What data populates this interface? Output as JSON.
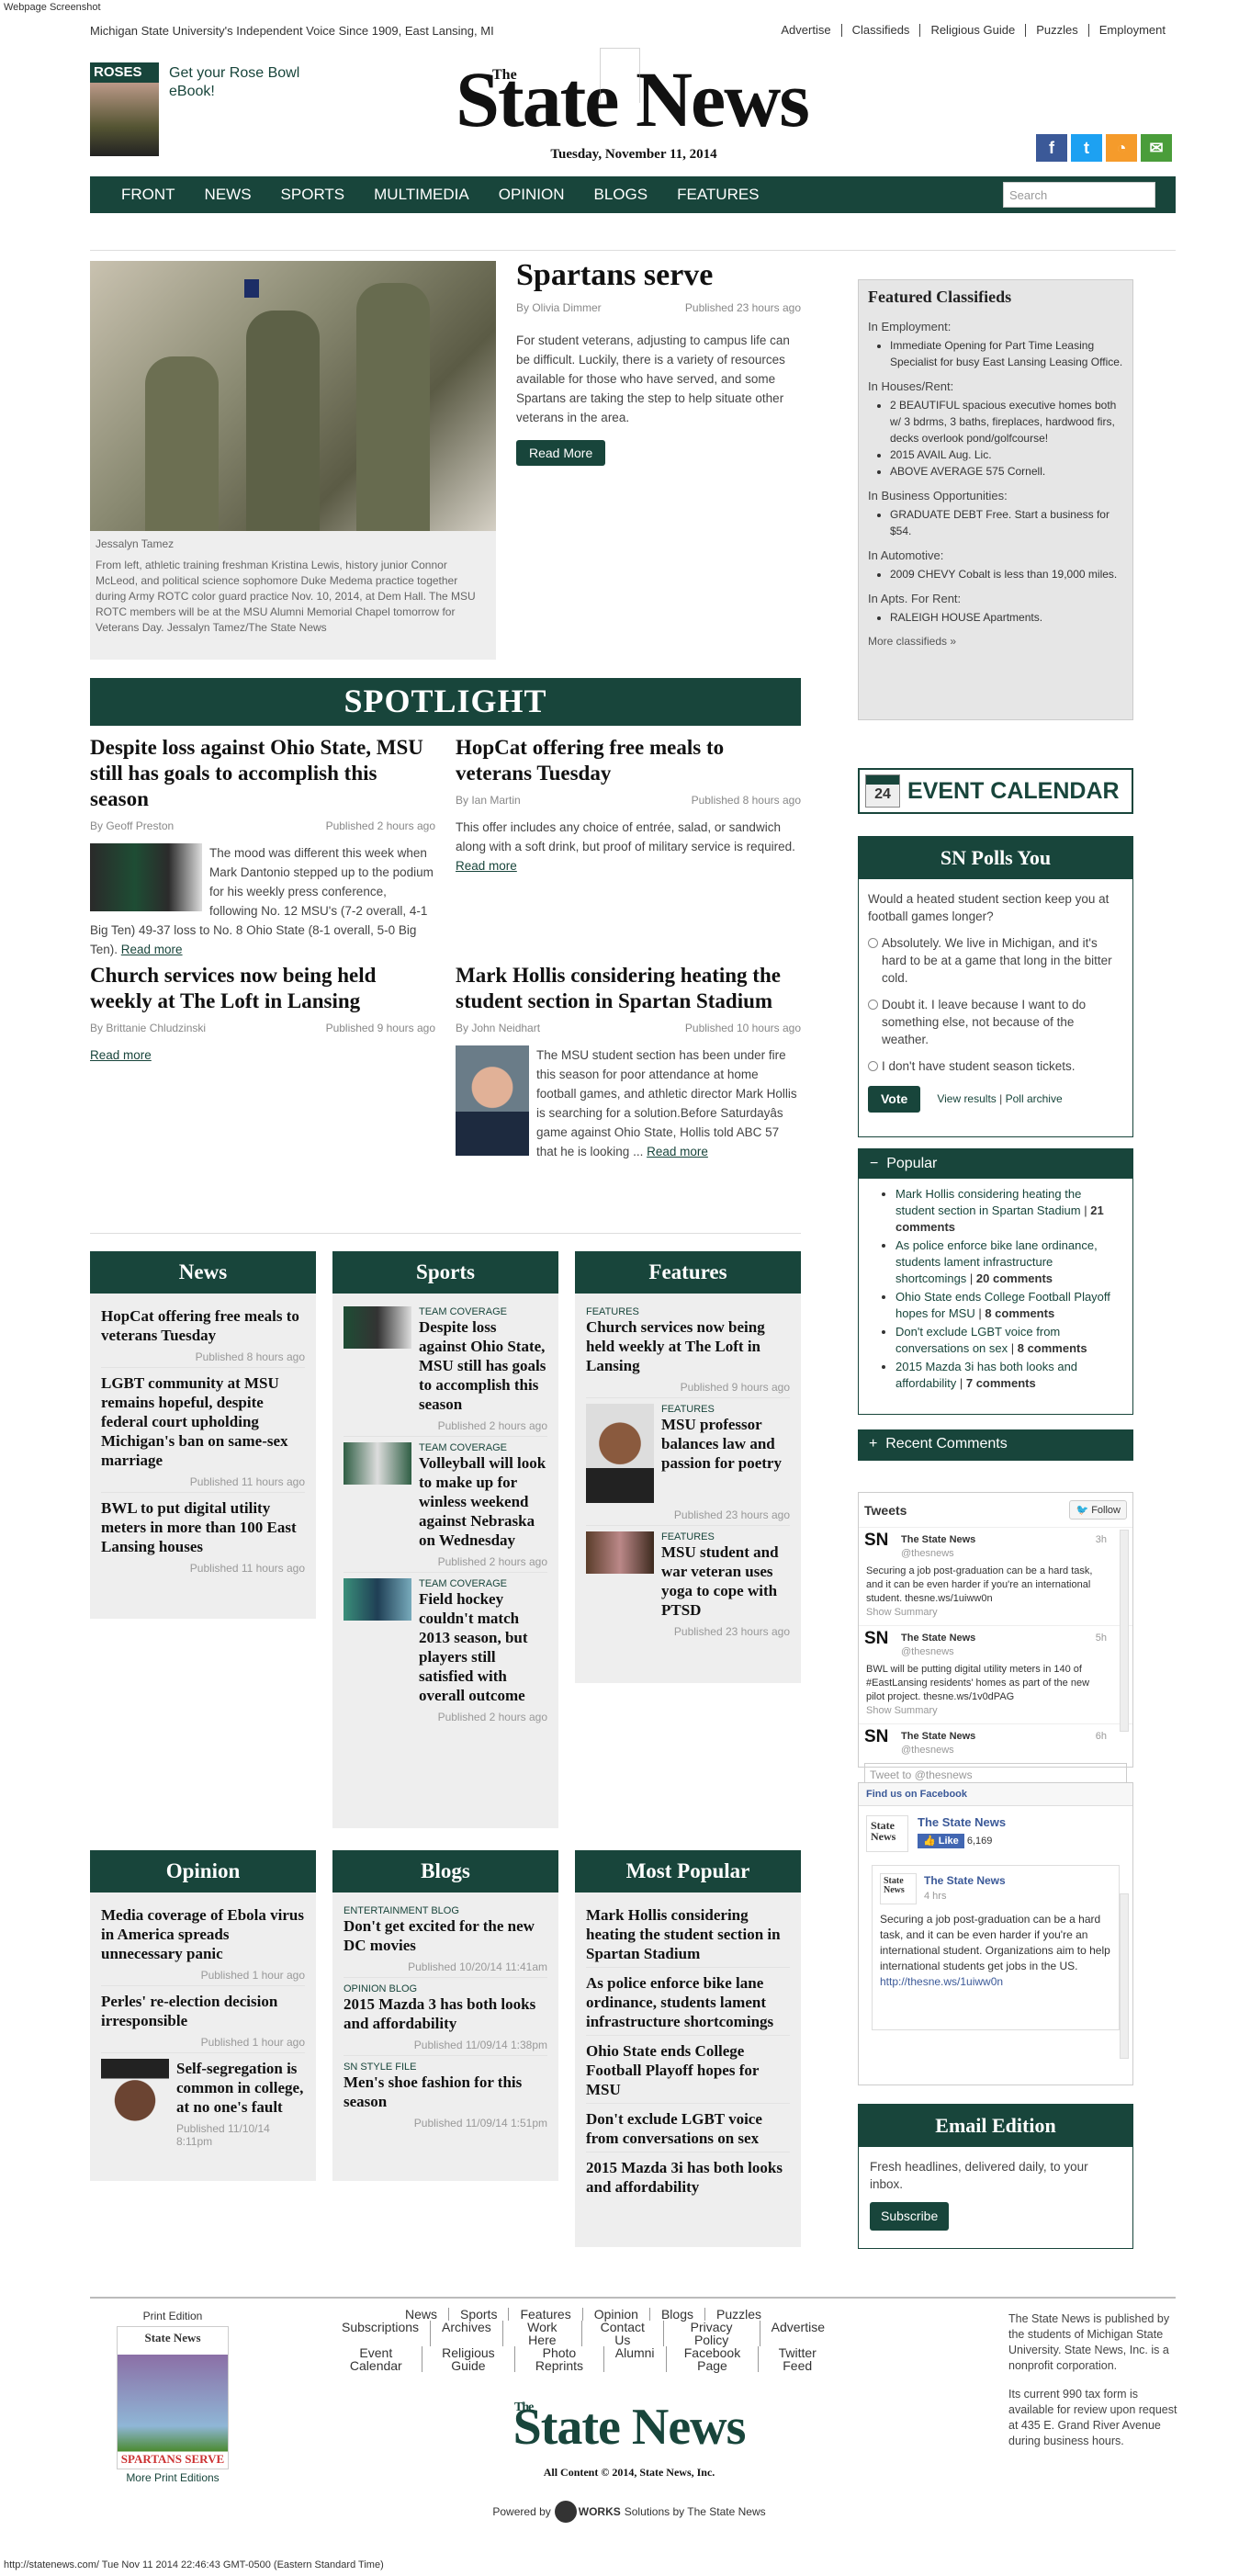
{
  "screenshot_label": "Webpage Screenshot",
  "topbar": {
    "tagline": "Michigan State University's Independent Voice Since 1909, East Lansing, MI",
    "links": [
      "Advertise",
      "Classifieds",
      "Religious Guide",
      "Puzzles",
      "Employment"
    ]
  },
  "promo": {
    "thumb_label": "ROSES",
    "text": "Get your Rose Bowl eBook!"
  },
  "masthead": {
    "the": "The",
    "name": "State News",
    "date": "Tuesday, November 11, 2014"
  },
  "social_icons": [
    "facebook-icon",
    "twitter-icon",
    "rss-icon",
    "email-icon"
  ],
  "nav": {
    "items": [
      "FRONT",
      "NEWS",
      "SPORTS",
      "MULTIMEDIA",
      "OPINION",
      "BLOGS",
      "FEATURES"
    ],
    "search_placeholder": "Search"
  },
  "feature": {
    "credit": "Jessalyn Tamez",
    "caption": "From left, athletic training freshman Kristina Lewis, history junior Connor McLeod, and political science sophomore Duke Medema practice together during Army ROTC color guard practice Nov. 10, 2014, at Dem Hall. The MSU ROTC members will be at the MSU Alumni Memorial Chapel tomorrow for Veterans Day. Jessalyn Tamez/The State News",
    "headline": "Spartans serve",
    "byline": "By Olivia Dimmer",
    "published": "Published 23 hours ago",
    "body": "For student veterans, adjusting to campus life can be difficult. Luckily, there is a variety of resources available for those who have served, and some Spartans are taking the step to help situate other veterans in the area.",
    "button": "Read More"
  },
  "spotlight": {
    "title": "SPOTLIGHT",
    "stories": [
      {
        "headline": "Despite loss against Ohio State, MSU still has goals to accomplish this season",
        "byline": "By Geoff Preston",
        "published": "Published 2 hours ago",
        "body": "The mood was different this week when Mark Dantonio stepped up to the podium for his weekly press conference, following No. 12 MSU's (7-2 overall, 4-1 Big Ten) 49-37 loss to No. 8 Ohio State (8-1 overall, 5-0 Big Ten).",
        "readmore": "Read more"
      },
      {
        "headline": "HopCat offering free meals to veterans Tuesday",
        "byline": "By Ian Martin",
        "published": "Published 8 hours ago",
        "body": "This offer includes any choice of entrée, salad, or sandwich along with a soft drink, but proof of military service is required.",
        "readmore": "Read more"
      },
      {
        "headline": "Church services now being held weekly at The Loft in Lansing",
        "byline": "By Brittanie Chludzinski",
        "published": "Published 9 hours ago",
        "body": "",
        "readmore": "Read more"
      },
      {
        "headline": "Mark Hollis considering heating the student section in Spartan Stadium",
        "byline": "By John Neidhart",
        "published": "Published 10 hours ago",
        "body": "The MSU student section has been under fire this season for poor attendance at home football games, and athletic director Mark Hollis is searching for a solution.Before Saturdayâs game against Ohio State, Hollis told ABC 57 that he is looking ...",
        "readmore": "Read more"
      }
    ]
  },
  "sections": {
    "news": {
      "title": "News",
      "items": [
        {
          "headline": "HopCat offering free meals to veterans Tuesday",
          "published": "Published 8 hours ago"
        },
        {
          "headline": "LGBT community at MSU remains hopeful, despite federal court upholding Michigan's ban on same-sex marriage",
          "published": "Published 11 hours ago"
        },
        {
          "headline": "BWL to put digital utility meters in more than 100 East Lansing houses",
          "published": "Published 11 hours ago"
        }
      ]
    },
    "sports": {
      "title": "Sports",
      "items": [
        {
          "kicker": "TEAM COVERAGE",
          "headline": "Despite loss against Ohio State, MSU still has goals to accomplish this season",
          "published": "Published 2 hours ago"
        },
        {
          "kicker": "TEAM COVERAGE",
          "headline": "Volleyball will look to make up for winless weekend against Nebraska on Wednesday",
          "published": "Published 2 hours ago"
        },
        {
          "kicker": "TEAM COVERAGE",
          "headline": "Field hockey couldn't match 2013 season, but players still satisfied with overall outcome",
          "published": "Published 2 hours ago"
        }
      ]
    },
    "features": {
      "title": "Features",
      "items": [
        {
          "kicker": "FEATURES",
          "headline": "Church services now being held weekly at The Loft in Lansing",
          "published": "Published 9 hours ago"
        },
        {
          "kicker": "FEATURES",
          "headline": "MSU professor balances law and passion for poetry",
          "published": "Published 23 hours ago"
        },
        {
          "kicker": "FEATURES",
          "headline": "MSU student and war veteran uses yoga to cope with PTSD",
          "published": "Published 23 hours ago"
        }
      ]
    },
    "opinion": {
      "title": "Opinion",
      "items": [
        {
          "headline": "Media coverage of Ebola virus in America spreads unnecessary panic",
          "published": "Published 1 hour ago"
        },
        {
          "headline": "Perles' re-election decision irresponsible",
          "published": "Published 1 hour ago"
        },
        {
          "headline": "Self-segregation is common in college, at no one's fault",
          "published": "Published 11/10/14 8:11pm"
        }
      ]
    },
    "blogs": {
      "title": "Blogs",
      "items": [
        {
          "kicker": "ENTERTAINMENT BLOG",
          "headline": "Don't get excited for the new DC movies",
          "published": "Published 10/20/14 11:41am"
        },
        {
          "kicker": "OPINION BLOG",
          "headline": "2015 Mazda 3 has both looks and affordability",
          "published": "Published 11/09/14 1:38pm"
        },
        {
          "kicker": "SN STYLE FILE",
          "headline": "Men's shoe fashion for this season",
          "published": "Published 11/09/14 1:51pm"
        }
      ]
    },
    "most_popular": {
      "title": "Most Popular",
      "items": [
        "Mark Hollis considering heating the student section in Spartan Stadium",
        "As police enforce bike lane ordinance, students lament infrastructure shortcomings",
        "Ohio State ends College Football Playoff hopes for MSU",
        "Don't exclude LGBT voice from conversations on sex",
        "2015 Mazda 3i has both looks and affordability"
      ]
    }
  },
  "classifieds": {
    "title": "Featured Classifieds",
    "groups": [
      {
        "label": "In Employment:",
        "items": [
          "Immediate Opening for Part Time Leasing Specialist for busy East Lansing Leasing Office."
        ]
      },
      {
        "label": "In Houses/Rent:",
        "items": [
          "2 BEAUTIFUL spacious executive homes both w/ 3 bdrms, 3 baths, fireplaces, hardwood firs, decks overlook pond/golfcourse!",
          "2015 AVAIL Aug. Lic.",
          "ABOVE AVERAGE 575 Cornell."
        ]
      },
      {
        "label": "In Business Opportunities:",
        "items": [
          "GRADUATE DEBT Free. Start a business for $54."
        ]
      },
      {
        "label": "In Automotive:",
        "items": [
          "2009 CHEVY Cobalt is less than 19,000 miles."
        ]
      },
      {
        "label": "In Apts. For Rent:",
        "items": [
          "RALEIGH HOUSE Apartments."
        ]
      }
    ],
    "more": "More classifieds »"
  },
  "event_calendar": {
    "day": "24",
    "title": "EVENT CALENDAR"
  },
  "poll": {
    "title": "SN Polls You",
    "question": "Would a heated student section keep you at football games longer?",
    "options": [
      "Absolutely. We live in Michigan, and it's hard to be at a game that long in the bitter cold.",
      "Doubt it. I leave because I want to do something else, not because of the weather.",
      "I don't have student season tickets."
    ],
    "vote": "Vote",
    "view_results": "View results",
    "archive": "Poll archive"
  },
  "popular": {
    "title": "Popular",
    "items": [
      {
        "title": "Mark Hollis considering heating the student section in Spartan Stadium",
        "count": "21 comments"
      },
      {
        "title": "As police enforce bike lane ordinance, students lament infrastructure shortcomings",
        "count": "20 comments"
      },
      {
        "title": "Ohio State ends College Football Playoff hopes for MSU",
        "count": "8 comments"
      },
      {
        "title": "Don't exclude LGBT voice from conversations on sex",
        "count": "8 comments"
      },
      {
        "title": "2015 Mazda 3i has both looks and affordability",
        "count": "7 comments"
      }
    ]
  },
  "recent_comments": {
    "title": "Recent Comments"
  },
  "tweets": {
    "title": "Tweets",
    "follow": "Follow",
    "items": [
      {
        "name": "The State News",
        "handle": "@thesnews",
        "time": "3h",
        "text": "Securing a job post-graduation can be a hard task, and it can be even harder if you're an international student. thesne.ws/1uiww0n",
        "summary": "Show Summary"
      },
      {
        "name": "The State News",
        "handle": "@thesnews",
        "time": "5h",
        "text": "BWL will be putting digital utility meters in 140 of #EastLansing residents' homes as part of the new pilot project. thesne.ws/1v0dPAG",
        "summary": "Show Summary"
      },
      {
        "name": "The State News",
        "handle": "@thesnews",
        "time": "6h",
        "text": "",
        "summary": ""
      }
    ],
    "input_placeholder": "Tweet to @thesnews"
  },
  "facebook": {
    "header": "Find us on Facebook",
    "page_name": "The State News",
    "like": "Like",
    "likes": "6,169",
    "post_name": "The State News",
    "post_time": "4 hrs",
    "post_text": "Securing a job post-graduation can be a hard task, and it can be even harder if you're an international student. Organizations aim to help international students get jobs in the US.",
    "post_link": "http://thesne.ws/1uiww0n"
  },
  "email_edition": {
    "title": "Email Edition",
    "text": "Fresh headlines, delivered daily, to your inbox.",
    "button": "Subscribe"
  },
  "footer": {
    "print_title": "Print Edition",
    "print_more": "More Print Editions",
    "cover_title": "State News",
    "cover_head": "SPARTANS SERVE",
    "links_rows": [
      [
        "News",
        "Sports",
        "Features",
        "Opinion",
        "Blogs",
        "Puzzles"
      ],
      [
        "Subscriptions",
        "Archives",
        "Work Here",
        "Contact Us",
        "Privacy Policy",
        "Advertise"
      ],
      [
        "Event Calendar",
        "Religious Guide",
        "Photo Reprints",
        "Alumni",
        "Facebook Page",
        "Twitter Feed"
      ]
    ],
    "logo_the": "The",
    "logo": "State News",
    "copyright": "All Content © 2014, State News, Inc.",
    "powered_pre": "Powered by",
    "powered_logo": "WORKS",
    "powered_post": "Solutions by The State News",
    "about_1": "The State News is published by the students of Michigan State University. State News, Inc. is a nonprofit corporation.",
    "about_2": "Its current 990 tax form is available for review upon request at 435 E. Grand River Avenue during business hours."
  },
  "status_bar": "http://statenews.com/ Tue Nov 11 2014 22:46:43 GMT-0500 (Eastern Standard Time)",
  "colors": {
    "brand_green": "#18453b",
    "facebook": "#3b5998",
    "twitter": "#1da1f2",
    "rss": "#f59b2b",
    "email": "#4a9d3a"
  }
}
